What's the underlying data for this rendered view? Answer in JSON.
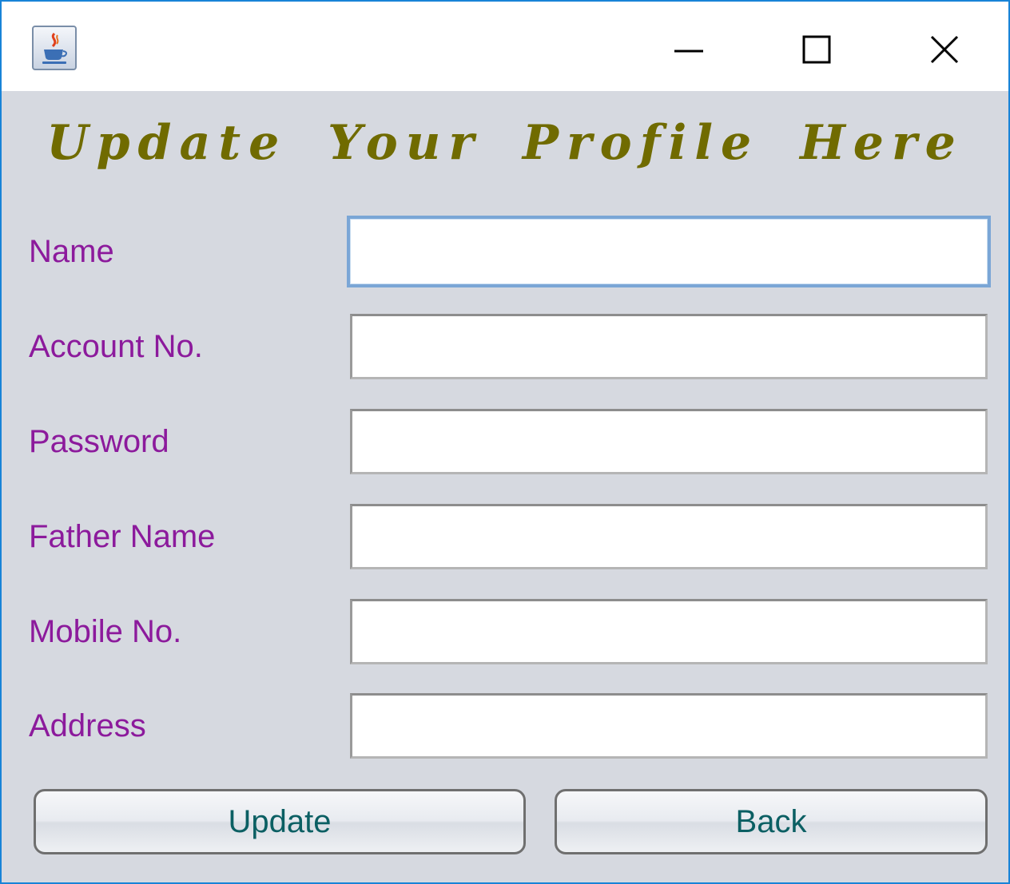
{
  "window": {
    "icon": "java-coffee-cup-icon",
    "controls": [
      "minimize-icon",
      "maximize-icon",
      "close-icon"
    ]
  },
  "form": {
    "heading": "Update Your Profile Here",
    "fields": [
      {
        "label": "Name",
        "value": "",
        "placeholder": ""
      },
      {
        "label": "Account No.",
        "value": "",
        "placeholder": ""
      },
      {
        "label": "Password",
        "value": "",
        "placeholder": ""
      },
      {
        "label": "Father Name",
        "value": "",
        "placeholder": ""
      },
      {
        "label": "Mobile No.",
        "value": "",
        "placeholder": ""
      },
      {
        "label": "Address",
        "value": "",
        "placeholder": ""
      }
    ],
    "buttons": {
      "update_label": "Update",
      "back_label": "Back"
    }
  },
  "colors": {
    "heading": "#706b00",
    "labels": "#8c1a9c",
    "button_text": "#0b5f63",
    "background": "#d6d9e0",
    "window_border": "#1883d7",
    "focus_border": "#7aa6d6"
  }
}
